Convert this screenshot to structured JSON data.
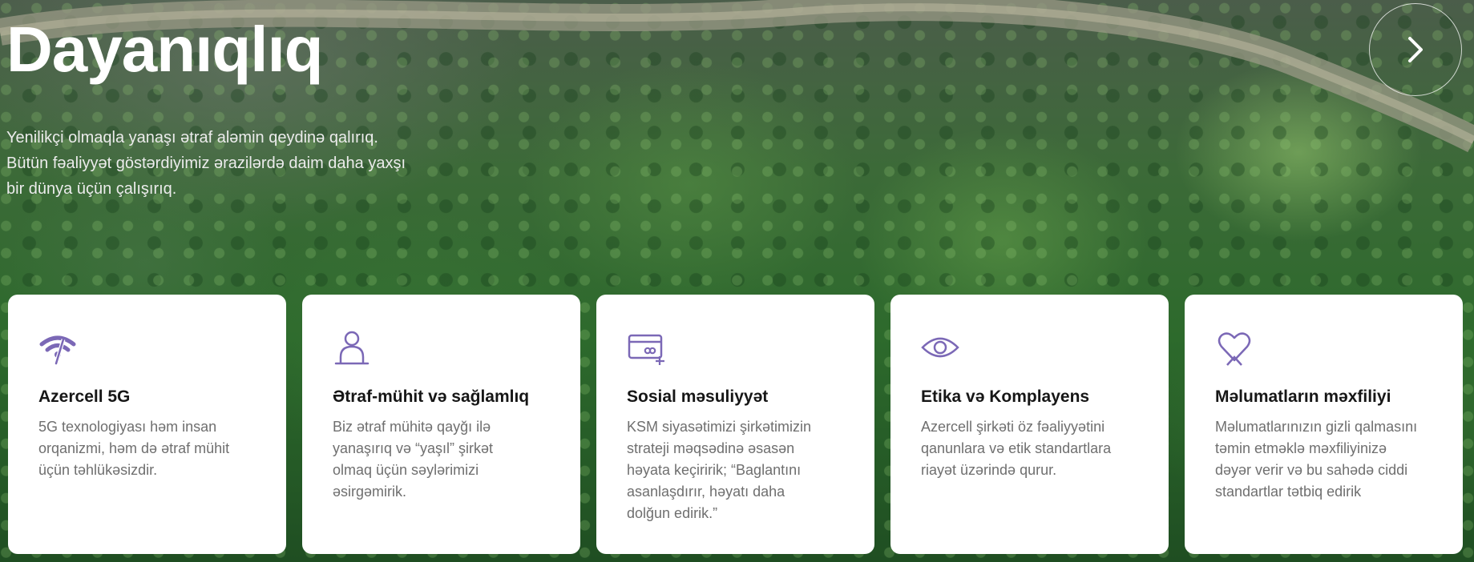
{
  "hero": {
    "title": "Dayanıqlıq",
    "subtitle_lines": [
      "Yenilikçi olmaqla yanaşı ətraf aləmin qeydinə qalırıq.",
      "Bütün fəaliyyət göstərdiyimiz ərazilərdə daim daha yaxşı",
      "bir dünya üçün çalışırıq."
    ],
    "next_icon": "chevron-right-icon"
  },
  "cards": [
    {
      "icon": "5g-signal-icon",
      "title": "Azercell 5G",
      "lines": [
        "5G texnologiyası həm insan",
        "orqanizmi, həm də ətraf mühit",
        "üçün təhlükəsizdir."
      ]
    },
    {
      "icon": "person-icon",
      "title": "Ətraf-mühit və sağlamlıq",
      "lines": [
        "Biz ətraf mühitə qayğı ilə",
        "yanaşırıq və “yaşıl” şirkət",
        "olmaq üçün səylərimizi",
        "əsirgəmirik."
      ]
    },
    {
      "icon": "card-icon",
      "title": "Sosial məsuliyyət",
      "lines": [
        "KSM siyasətimizi şirkətimizin",
        "strateji məqsədinə əsasən",
        "həyata keçiririk; “Baglantını",
        "asanlaşdırır, həyatı daha",
        "dolğun edirik.”"
      ]
    },
    {
      "icon": "eye-icon",
      "title": "Etika və Komplayens",
      "lines": [
        "Azercell şirkəti öz fəaliyyətini",
        "qanunlara və etik standartlara",
        "riayət üzərində qurur."
      ]
    },
    {
      "icon": "heart-icon",
      "title": "Məlumatların məxfiliyi",
      "lines": [
        "Məlumatlarınızın gizli qalmasını",
        "təmin etməklə məxfiliyinizə",
        "dəyər verir və bu sahədə ciddi",
        "standartlar tətbiq edirik"
      ]
    }
  ],
  "colors": {
    "icon_accent": "#7b68b6",
    "card_bg": "#ffffff",
    "title_text": "#161616",
    "body_text": "#6f6f6f"
  }
}
